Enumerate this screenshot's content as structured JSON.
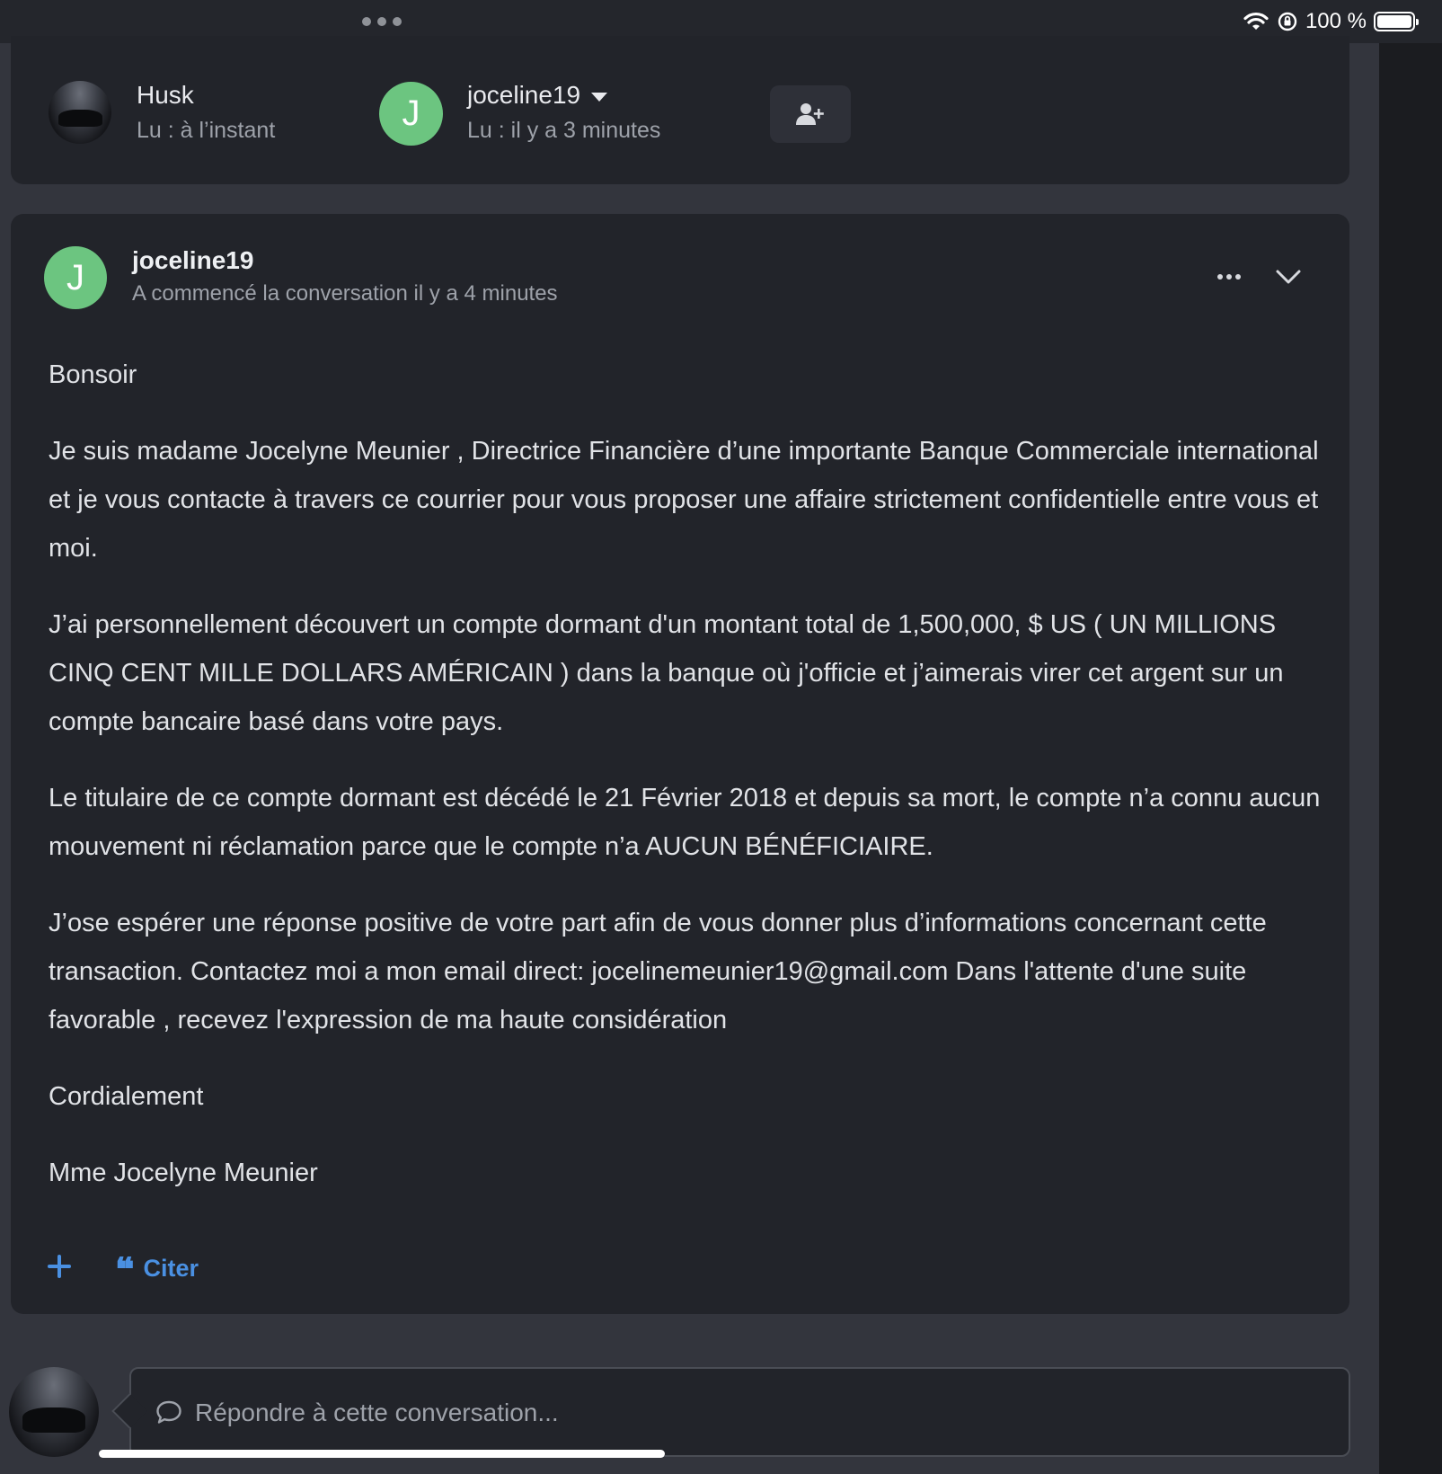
{
  "status_bar": {
    "battery_text": "100 %",
    "icons": [
      "more-dots-icon",
      "wifi-icon",
      "orientation-lock-icon",
      "battery-icon"
    ]
  },
  "participants": [
    {
      "name": "Husk",
      "read": "Lu : à l’instant",
      "avatar": "photo"
    },
    {
      "name": "joceline19",
      "read": "Lu : il y a 3 minutes",
      "avatar_letter": "J"
    }
  ],
  "add_participant": {
    "icon": "user-plus-icon"
  },
  "message": {
    "avatar_letter": "J",
    "author": "joceline19",
    "started": "A commencé la conversation il y a 4 minutes",
    "paragraphs": [
      "Bonsoir",
      "Je suis madame Jocelyne Meunier , Directrice Financière d’une importante Banque Commerciale international et je vous contacte à travers ce courrier pour vous proposer une affaire strictement confidentielle entre vous et moi.",
      "J’ai personnellement découvert un compte dormant d'un montant total de 1,500,000, $ US ( UN MILLIONS CINQ CENT MILLE DOLLARS AMÉRICAIN ) dans la banque où j'officie et j’aimerais virer cet argent sur un compte bancaire basé dans votre pays.",
      "Le titulaire de ce compte dormant est décédé le 21 Février 2018 et depuis sa mort, le compte n’a connu aucun mouvement ni réclamation parce que le compte n’a AUCUN BÉNÉFICIAIRE.",
      "J’ose espérer une réponse positive de votre part afin de vous donner plus d’informations concernant cette transaction. Contactez moi a mon email direct: jocelinemeunier19@gmail.com Dans l'attente d'une suite favorable , recevez l'expression de ma haute considération",
      "Cordialement",
      "Mme Jocelyne Meunier"
    ],
    "quote_label": "Citer",
    "quote_glyph": "❝"
  },
  "reply": {
    "placeholder": "Répondre à cette conversation..."
  },
  "colors": {
    "accent": "#4a90e2",
    "avatar_green": "#6cc580",
    "card_bg": "#22242a",
    "page_bg": "#33353d"
  }
}
